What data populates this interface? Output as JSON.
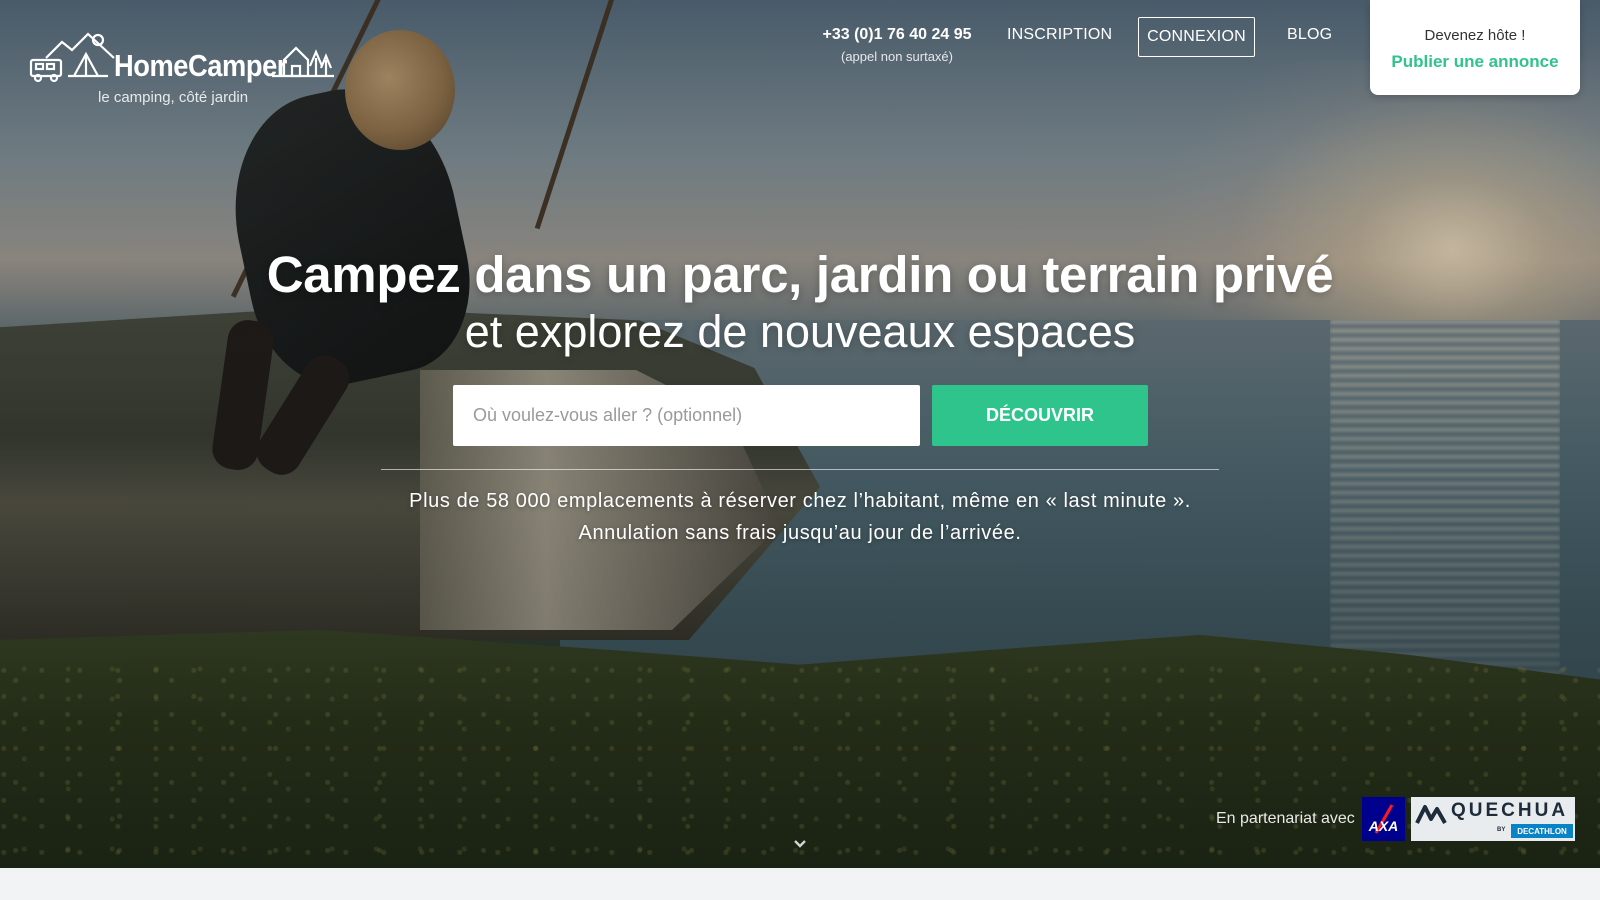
{
  "brand": {
    "name": "HomeCamper",
    "tagline": "le camping, côté jardin"
  },
  "nav": {
    "phone_number": "+33 (0)1 76 40 24 95",
    "phone_note": "(appel non surtaxé)",
    "inscription": "INSCRIPTION",
    "connexion": "CONNEXION",
    "blog": "BLOG"
  },
  "host_card": {
    "title": "Devenez hôte !",
    "link": "Publier une annonce"
  },
  "hero": {
    "headline": "Campez dans un parc, jardin ou terrain privé",
    "subheadline": "et explorez de nouveaux espaces"
  },
  "search": {
    "placeholder": "Où voulez-vous aller ? (optionnel)",
    "value": "",
    "button_label": "DÉCOUVRIR"
  },
  "info": {
    "line1": "Plus de 58 000 emplacements à réserver chez l’habitant, même en « last minute ».",
    "line2": "Annulation sans frais jusqu’au jour de l’arrivée."
  },
  "partners": {
    "label": "En partenariat avec",
    "axa": "AXA",
    "quechua": "QUECHUA",
    "quechua_by": "BY",
    "decathlon": "DECATHLON"
  },
  "colors": {
    "accent": "#2ec48c",
    "axa_blue": "#00008f",
    "decathlon_blue": "#0a83c6"
  },
  "icons": [
    "campervan-icon",
    "tent-mountain-icon",
    "house-tree-icon",
    "chevron-down-icon"
  ]
}
